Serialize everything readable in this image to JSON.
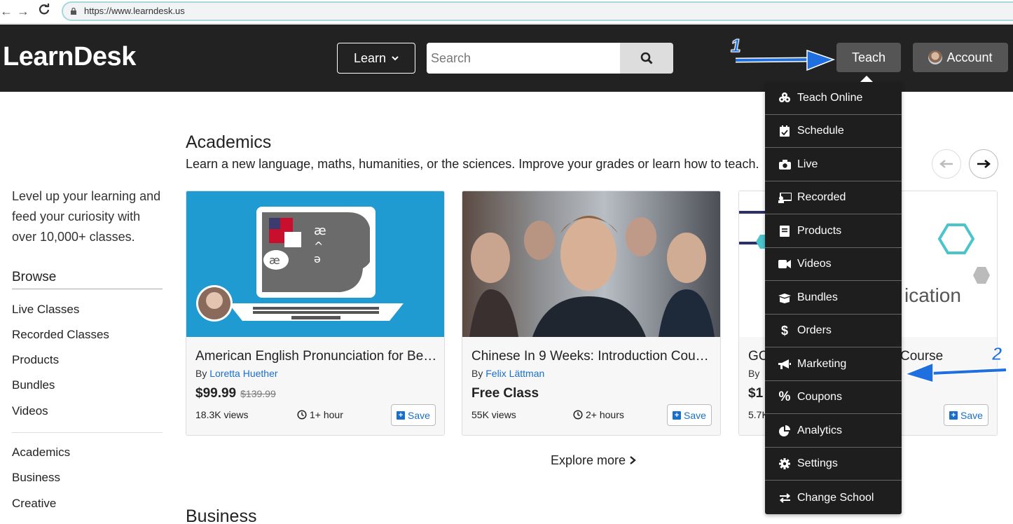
{
  "browser": {
    "url": "https://www.learndesk.us"
  },
  "header": {
    "logo": "LearnDesk",
    "learn_label": "Learn",
    "search_placeholder": "Search",
    "teach_label": "Teach",
    "account_label": "Account"
  },
  "sidebar": {
    "tagline": "Level up your learning and feed your curiosity with over 10,000+ classes.",
    "browse_heading": "Browse",
    "browse_items": [
      "Live Classes",
      "Recorded Classes",
      "Products",
      "Bundles",
      "Videos"
    ],
    "category_items": [
      "Academics",
      "Business",
      "Creative"
    ]
  },
  "main": {
    "section_title": "Academics",
    "section_subtitle": "Learn a new language, maths, humanities, or the sciences. Improve your grades or learn how to teach.",
    "next_section_title": "Business",
    "explore_label": "Explore more",
    "cards": [
      {
        "title": "American English Pronunciation for Be…",
        "by": "By",
        "author": "Loretta Huether",
        "price": "$99.99",
        "old_price": "$139.99",
        "views": "18.3K views",
        "duration": "1+ hour",
        "save": "Save"
      },
      {
        "title": "Chinese In 9 Weeks: Introduction Cou…",
        "by": "By",
        "author": "Felix Lättman",
        "price": "Free Class",
        "old_price": "",
        "views": "55K views",
        "duration": "2+ hours",
        "save": "Save"
      },
      {
        "title_left": "GC",
        "title_right": "Course",
        "by": "By",
        "price": "$1",
        "views": "5.7K",
        "thumb_text": "ication",
        "save": "Save"
      }
    ]
  },
  "teach_menu": {
    "items": [
      {
        "label": "Teach Online",
        "icon": "teach-online-icon"
      },
      {
        "label": "Schedule",
        "icon": "calendar-icon"
      },
      {
        "label": "Live",
        "icon": "camera-icon"
      },
      {
        "label": "Recorded",
        "icon": "recorded-icon"
      },
      {
        "label": "Products",
        "icon": "book-icon"
      },
      {
        "label": "Videos",
        "icon": "video-icon"
      },
      {
        "label": "Bundles",
        "icon": "box-icon"
      },
      {
        "label": "Orders",
        "icon": "dollar-icon"
      },
      {
        "label": "Marketing",
        "icon": "megaphone-icon"
      },
      {
        "label": "Coupons",
        "icon": "percent-icon"
      },
      {
        "label": "Analytics",
        "icon": "pie-chart-icon"
      },
      {
        "label": "Settings",
        "icon": "gear-icon"
      },
      {
        "label": "Change School",
        "icon": "exchange-icon"
      }
    ]
  },
  "annotations": {
    "step1": "1",
    "step2": "2"
  },
  "colors": {
    "header_bg": "#222222",
    "accent_link": "#1a6fc9",
    "annotation_blue": "#1f6fe0"
  }
}
